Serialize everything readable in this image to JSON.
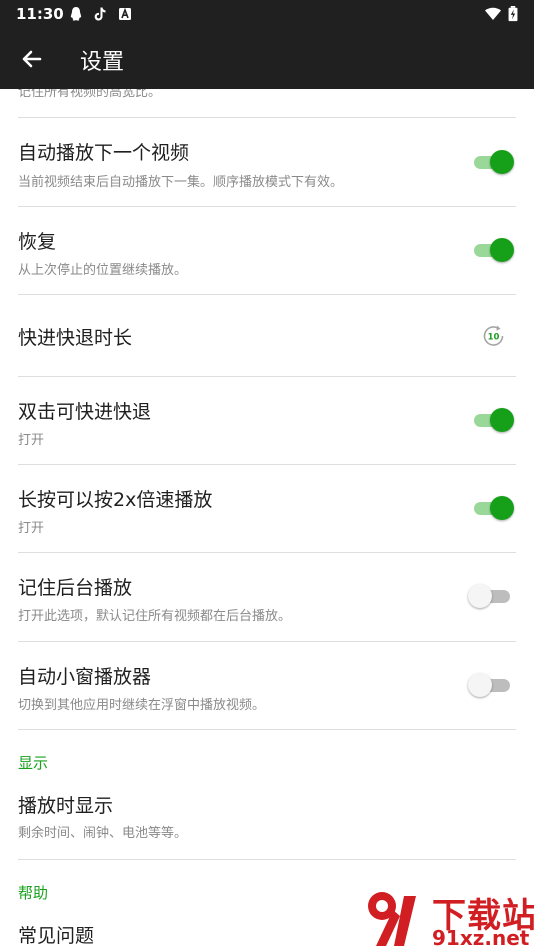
{
  "status_bar": {
    "time": "11:30"
  },
  "header": {
    "title": "设置"
  },
  "partial_top": {
    "subtitle": "记住所有视频的高宽比。"
  },
  "settings": [
    {
      "title": "自动播放下一个视频",
      "subtitle": "当前视频结束后自动播放下一集。顺序播放模式下有效。",
      "toggle": true
    },
    {
      "title": "恢复",
      "subtitle": "从上次停止的位置继续播放。",
      "toggle": true
    },
    {
      "title": "快进快退时长",
      "value_badge": "10"
    },
    {
      "title": "双击可快进快退",
      "subtitle": "打开",
      "toggle": true
    },
    {
      "title": "长按可以按2x倍速播放",
      "subtitle": "打开",
      "toggle": true
    },
    {
      "title": "记住后台播放",
      "subtitle": "打开此选项，默认记住所有视频都在后台播放。",
      "toggle": false
    },
    {
      "title": "自动小窗播放器",
      "subtitle": "切换到其他应用时继续在浮窗中播放视频。",
      "toggle": false
    }
  ],
  "display_section": {
    "header": "显示",
    "item": {
      "title": "播放时显示",
      "subtitle": "剩余时间、闹钟、电池等等。"
    }
  },
  "help_section": {
    "header": "帮助",
    "item": {
      "title": "常见问题"
    }
  },
  "watermark": {
    "title": "下载站",
    "site": "91xz.net"
  },
  "colors": {
    "accent": "#19a11e",
    "toolbar": "#202020"
  }
}
